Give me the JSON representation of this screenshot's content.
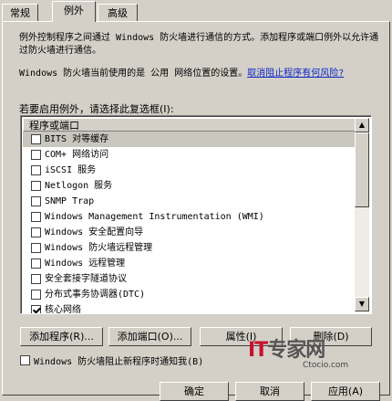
{
  "tabs": [
    "常规",
    "例外",
    "高级"
  ],
  "description": "例外控制程序之间通过 Windows 防火墙进行通信的方式。添加程序或端口例外以允许通过防火墙进行通信。",
  "location_text": "Windows 防火墙当前使用的是 公用 网络位置的设置。",
  "location_link": "取消阻止程序有何风险?",
  "instruction": "若要启用例外，请选择此复选框(I):",
  "list_header": "程序或端口",
  "items": [
    {
      "label": "BITS 对等缓存",
      "checked": false,
      "selected": true
    },
    {
      "label": "COM+ 网络访问",
      "checked": false,
      "selected": false
    },
    {
      "label": "iSCSI 服务",
      "checked": false,
      "selected": false
    },
    {
      "label": "Netlogon 服务",
      "checked": false,
      "selected": false
    },
    {
      "label": "SNMP Trap",
      "checked": false,
      "selected": false
    },
    {
      "label": "Windows Management Instrumentation (WMI)",
      "checked": false,
      "selected": false
    },
    {
      "label": "Windows 安全配置向导",
      "checked": false,
      "selected": false
    },
    {
      "label": "Windows 防火墙远程管理",
      "checked": false,
      "selected": false
    },
    {
      "label": "Windows 远程管理",
      "checked": false,
      "selected": false
    },
    {
      "label": "安全套接字隧道协议",
      "checked": false,
      "selected": false
    },
    {
      "label": "分布式事务协调器(DTC)",
      "checked": false,
      "selected": false
    },
    {
      "label": "核心网络",
      "checked": true,
      "selected": false
    }
  ],
  "buttons": {
    "add_program": "添加程序(R)...",
    "add_port": "添加端口(O)...",
    "properties": "属性(I)",
    "delete": "删除(D)"
  },
  "notify_checkbox": {
    "label": "Windows 防火墙阻止新程序时通知我(B)",
    "checked": false
  },
  "footer_buttons": {
    "ok": "确定",
    "cancel": "取消",
    "apply": "应用(A)"
  },
  "watermark": {
    "logo_it": "IT",
    "logo_rest": "专家网",
    "sub": "Ctocio.com"
  }
}
